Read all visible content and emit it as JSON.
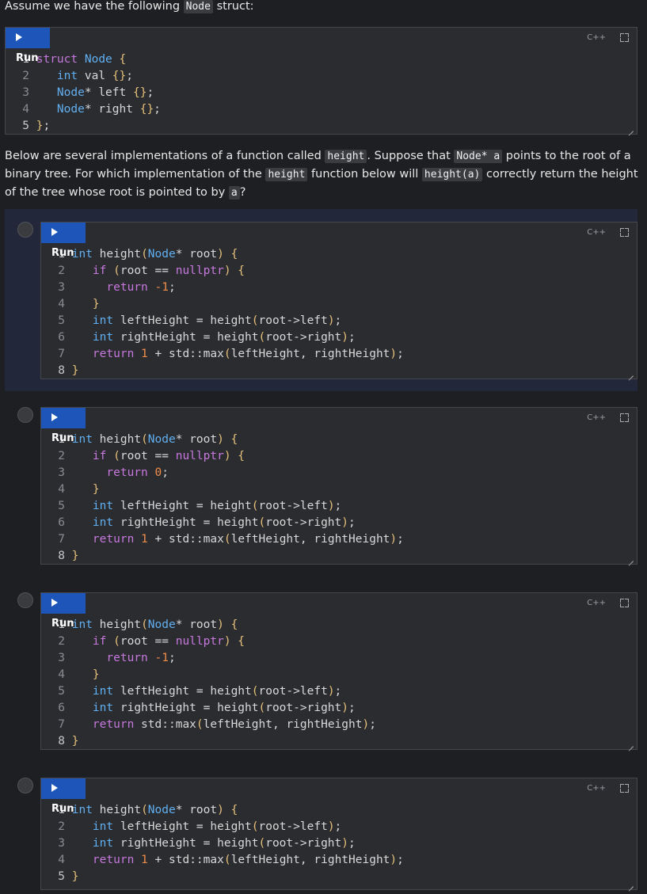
{
  "intro": {
    "before": "Assume we have the following ",
    "code": "Node",
    "after": " struct:"
  },
  "question": {
    "p1": "Below are several implementations of a function called ",
    "c1": "height",
    "p2": ". Suppose that ",
    "c2": "Node* a",
    "p3": " points to the root of a binary tree. For which implementation of the ",
    "c3": "height",
    "p4": " function below will ",
    "c4": "height(a)",
    "p5": " correctly return the height of the tree whose root is pointed to by ",
    "c5": "a",
    "p6": "?"
  },
  "run_label": "Run",
  "lang_label": "C++",
  "struct_block": {
    "lines": [
      "struct Node {",
      "  int val {};",
      "  Node* left {};",
      "  Node* right {};",
      "};"
    ]
  },
  "options": [
    {
      "selected": true,
      "lines": [
        "int height(Node* root) {",
        "  if (root == nullptr) {",
        "    return -1;",
        "  }",
        "  int leftHeight = height(root->left);",
        "  int rightHeight = height(root->right);",
        "  return 1 + std::max(leftHeight, rightHeight);",
        "}"
      ]
    },
    {
      "selected": false,
      "lines": [
        "int height(Node* root) {",
        "  if (root == nullptr) {",
        "    return 0;",
        "  }",
        "  int leftHeight = height(root->left);",
        "  int rightHeight = height(root->right);",
        "  return 1 + std::max(leftHeight, rightHeight);",
        "}"
      ]
    },
    {
      "selected": false,
      "lines": [
        "int height(Node* root) {",
        "  if (root == nullptr) {",
        "    return -1;",
        "  }",
        "  int leftHeight = height(root->left);",
        "  int rightHeight = height(root->right);",
        "  return std::max(leftHeight, rightHeight);",
        "}"
      ]
    },
    {
      "selected": false,
      "lines": [
        "int height(Node* root) {",
        "  int leftHeight = height(root->left);",
        "  int rightHeight = height(root->right);",
        "  return 1 + std::max(leftHeight, rightHeight);",
        "}"
      ]
    }
  ],
  "colors": {
    "run_button": "#1d56b8",
    "keyword": "#c678dd",
    "type": "#61aff0",
    "number": "#f08d49",
    "brace": "#e5c07b",
    "selected_option_bg": "#22283a"
  }
}
